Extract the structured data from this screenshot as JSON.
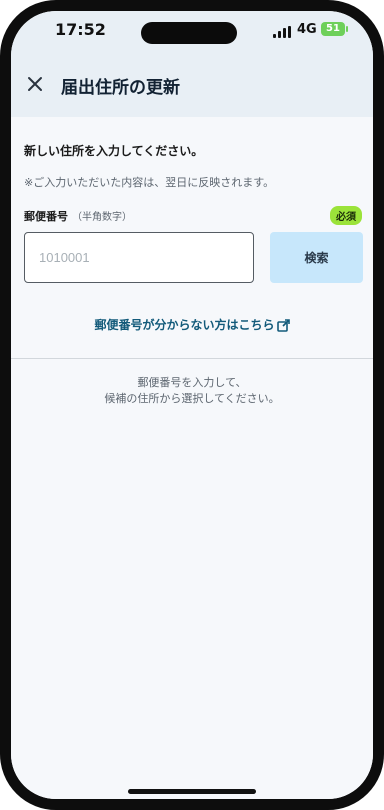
{
  "status": {
    "time": "17:52",
    "network": "4G",
    "battery": "51"
  },
  "header": {
    "title": "届出住所の更新",
    "close_icon": "close-icon"
  },
  "form": {
    "lead": "新しい住所を入力してください。",
    "note": "※ご入力いただいた内容は、翌日に反映されます。",
    "postal_label": "郵便番号",
    "postal_sub": "（半角数字）",
    "required_badge": "必須",
    "postal_placeholder": "1010001",
    "postal_value": "",
    "search_label": "検索",
    "unknown_link": "郵便番号が分からない方はこちら",
    "hint_line1": "郵便番号を入力して、",
    "hint_line2": "候補の住所から選択してください。"
  },
  "colors": {
    "accent": "#125a7a",
    "badge": "#9be33a",
    "search_button": "#c7e7fb",
    "header_bg": "#e8eff5"
  }
}
